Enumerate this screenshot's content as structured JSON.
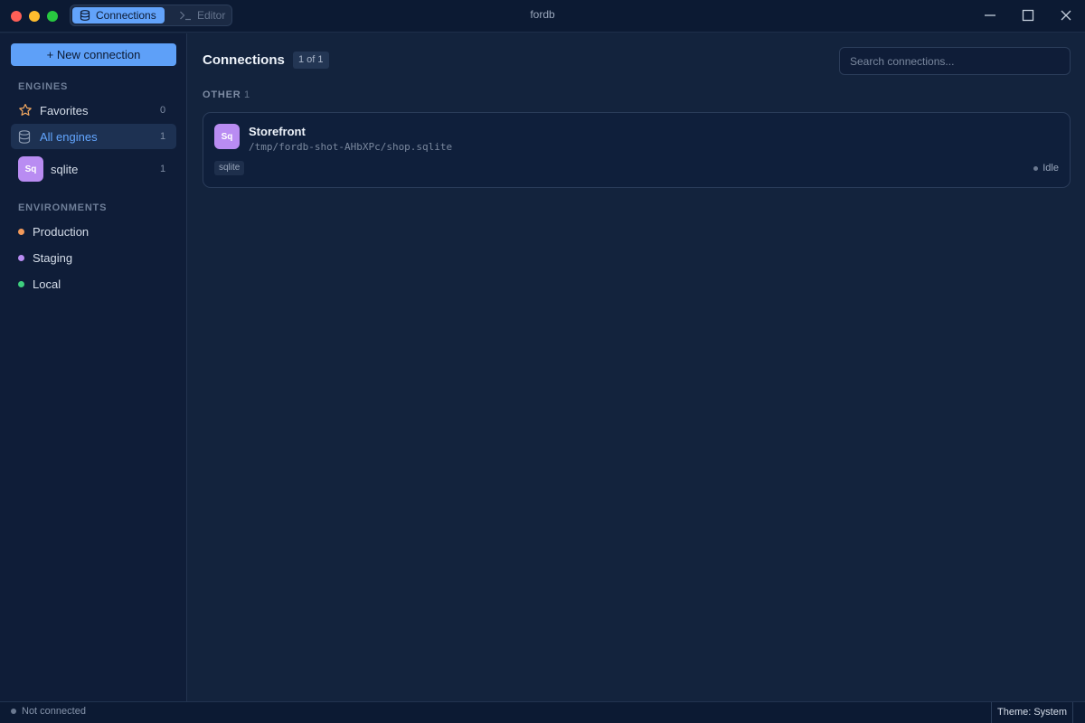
{
  "window": {
    "title": "fordb"
  },
  "tabs": [
    {
      "label": "Connections",
      "active": true,
      "icon": "database-icon"
    },
    {
      "label": "Editor",
      "active": false,
      "icon": "terminal-icon"
    }
  ],
  "sidebar": {
    "new_connection_label": "+ New connection",
    "engines_heading": "ENGINES",
    "engines": [
      {
        "label": "Favorites",
        "count": "0",
        "icon": "star-icon",
        "active": false
      },
      {
        "label": "All engines",
        "count": "1",
        "icon": "database-icon",
        "active": true
      },
      {
        "label": "sqlite",
        "count": "1",
        "icon": "sqlite-badge",
        "badge": "Sq",
        "active": false
      }
    ],
    "environments_heading": "ENVIRONMENTS",
    "environments": [
      {
        "label": "Production",
        "color": "#f2995a"
      },
      {
        "label": "Staging",
        "color": "#b98cf2"
      },
      {
        "label": "Local",
        "color": "#3ecf7e"
      }
    ]
  },
  "main": {
    "title": "Connections",
    "count_label": "1 of 1",
    "search_placeholder": "Search connections...",
    "groups": [
      {
        "name": "OTHER",
        "count": "1",
        "connections": [
          {
            "badge": "Sq",
            "name": "Storefront",
            "path": "/tmp/fordb-shot-AHbXPc/shop.sqlite",
            "tag": "sqlite",
            "status": "Idle"
          }
        ]
      }
    ]
  },
  "statusbar": {
    "connection_status": "Not connected",
    "theme_label": "Theme: System"
  },
  "colors": {
    "accent": "#5ea0f8",
    "sqlite_badge": "#b98cf2",
    "background": "#13233d",
    "sidebar": "#0f1d38"
  }
}
